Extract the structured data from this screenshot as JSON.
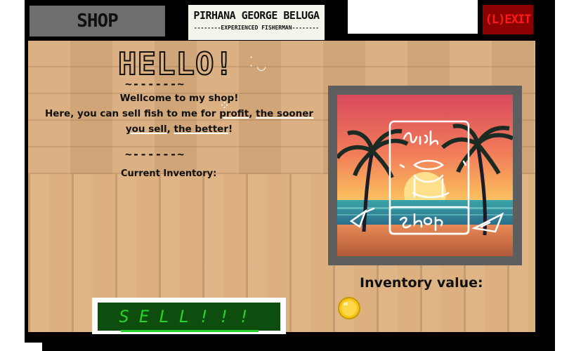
{
  "header": {
    "shop_tab_label": "SHOP",
    "npc_name": "PIRHANA GEORGE BELUGA",
    "npc_title": "--------EXPERIENCED FISHERMAN--------",
    "exit_label": "(L)EXIT"
  },
  "greeting": {
    "hello": "HELLO!",
    "tilde_line": "~------~",
    "welcome_line1": "Wellcome to my shop!",
    "welcome_line2a": "Here, you can sell fish to me for ",
    "welcome_profit": "profit",
    "welcome_line2b": ", ",
    "welcome_sooner": "the sooner",
    "welcome_sell": "you sell",
    "welcome_sep": ", ",
    "welcome_better": "the better",
    "welcome_end": "!",
    "current_inventory": "Current Inventory:"
  },
  "picture": {
    "sign_text_top": "fish",
    "sign_text_bottom": "Shop"
  },
  "inventory": {
    "value_label": "Inventory value:"
  },
  "actions": {
    "sell_label": "SELL!!!"
  },
  "colors": {
    "wood": "#ddb07f",
    "frame_gray": "#5e5e5e",
    "exit_bg": "#8b0000",
    "exit_text": "#ff1a1a",
    "sell_bg": "#0d4d0d",
    "sell_text": "#2bd12b"
  },
  "icons": {
    "coin": "gold-coin-icon"
  }
}
